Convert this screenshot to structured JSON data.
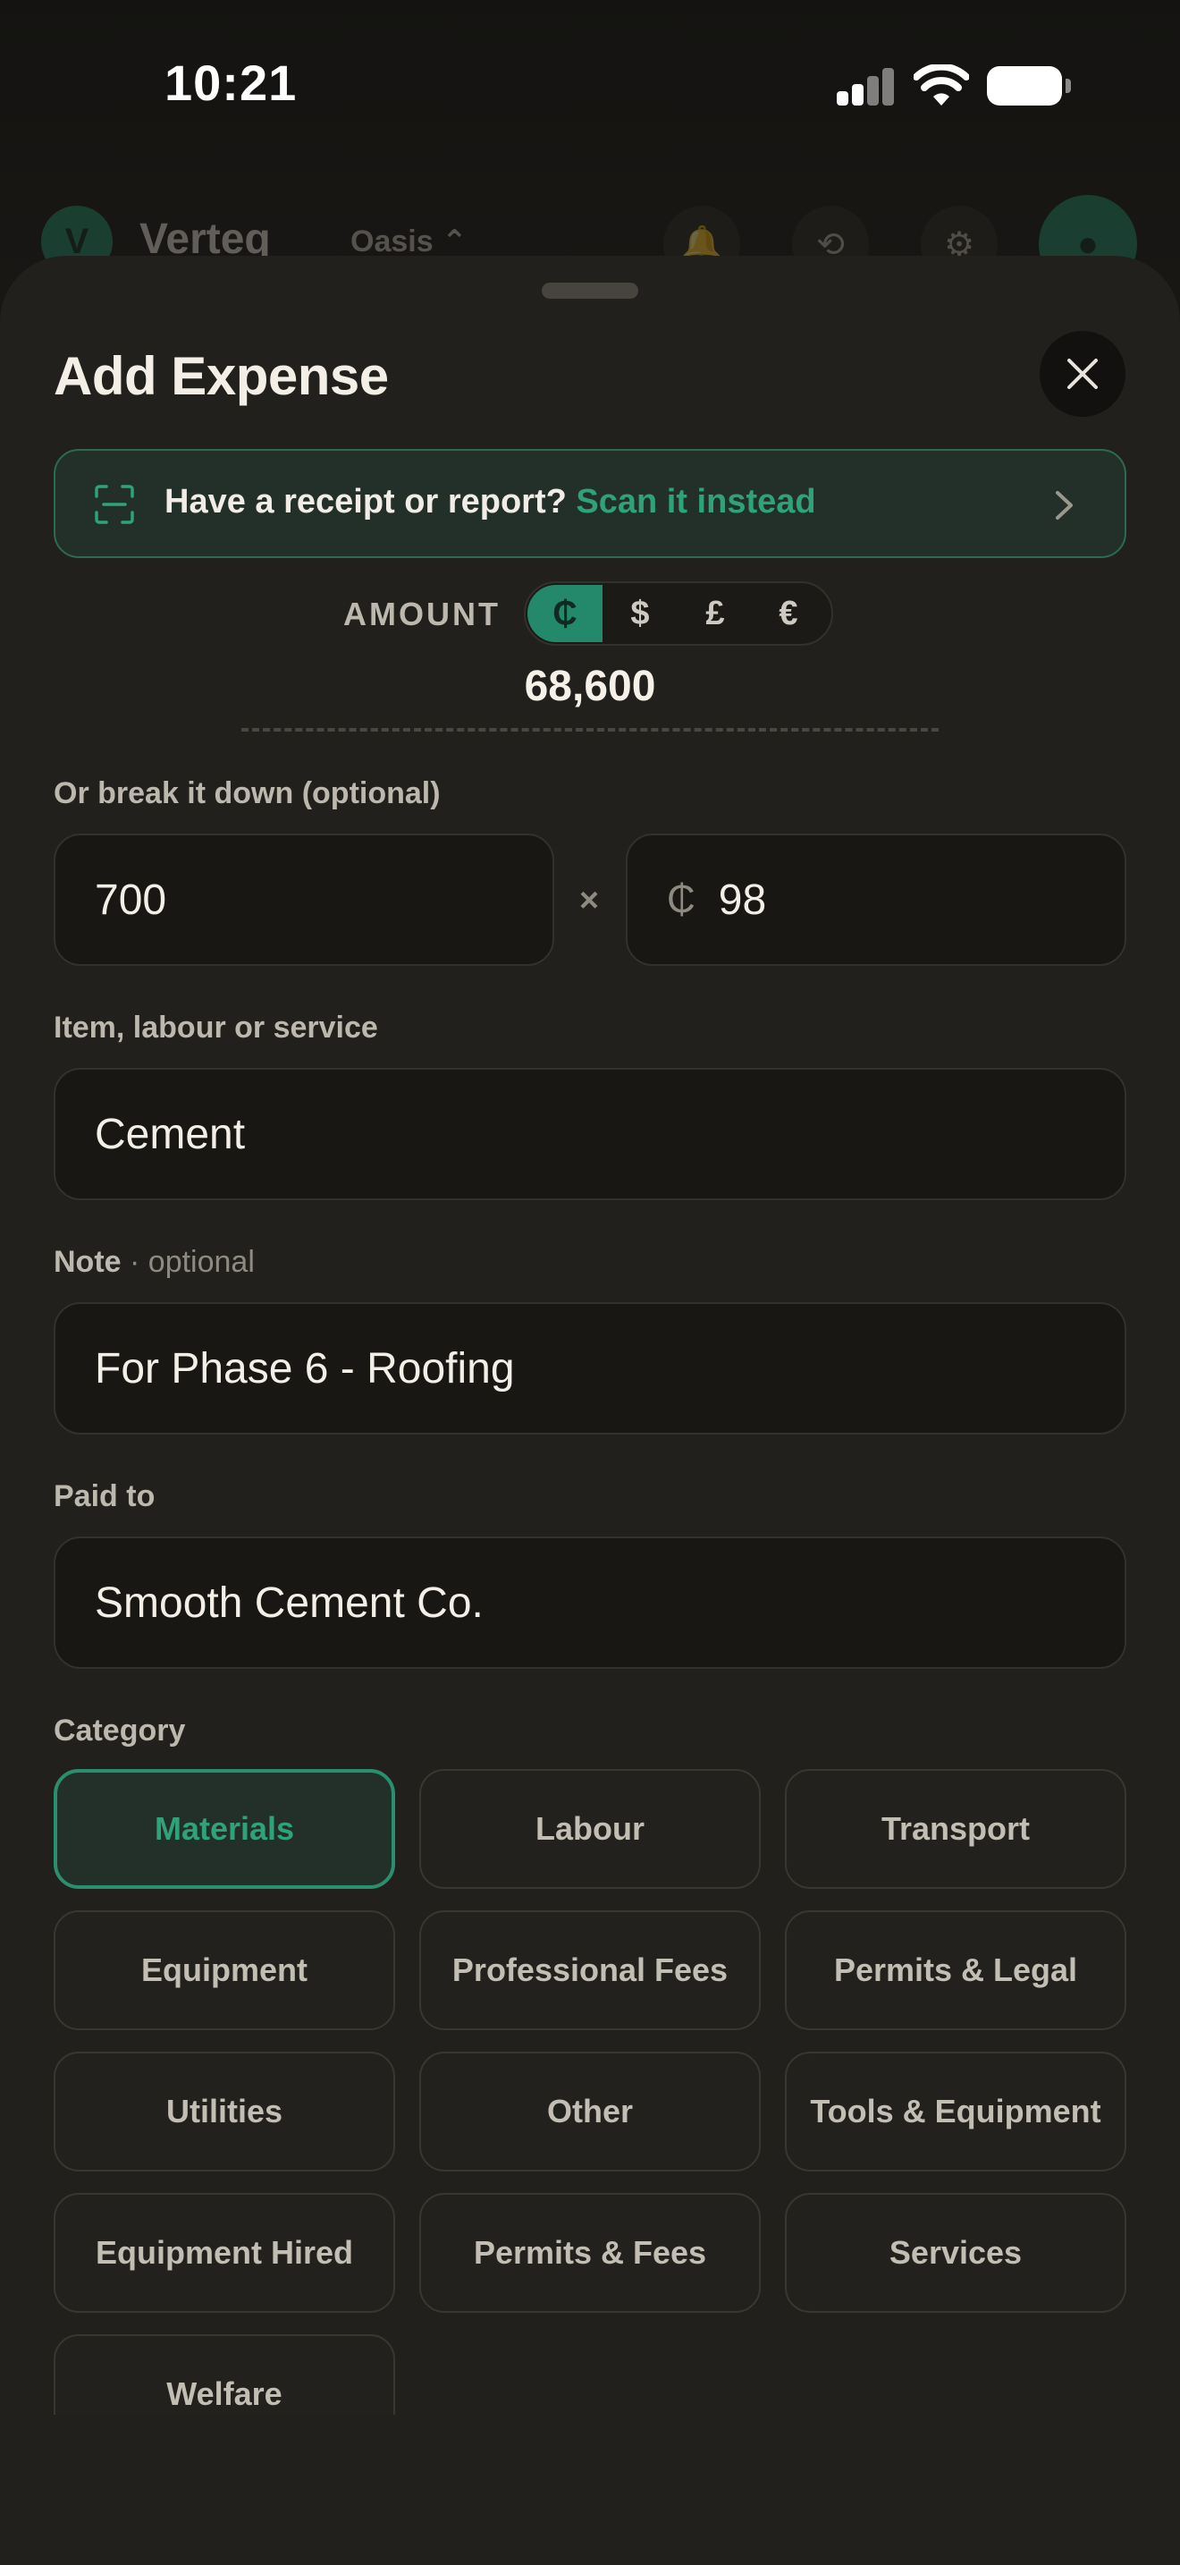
{
  "status": {
    "time": "10:21"
  },
  "app_header": {
    "app_name": "Verteq",
    "logo_letter": "V",
    "project": "Oasis ⌃"
  },
  "sheet": {
    "title": "Add Expense"
  },
  "scan": {
    "prompt": "Have a receipt or report?",
    "link": "Scan it instead"
  },
  "amount": {
    "label": "AMOUNT",
    "currencies": [
      "₵",
      "$",
      "£",
      "€"
    ],
    "selected_currency": "₵",
    "value": "68,600"
  },
  "breakdown": {
    "label": "Or break it down (optional)",
    "quantity": "700",
    "times_symbol": "×",
    "unit_currency": "₵",
    "unit_price": "98"
  },
  "item": {
    "label": "Item, labour or service",
    "value": "Cement"
  },
  "note": {
    "label": "Note",
    "optional": "· optional",
    "value": "For Phase 6 - Roofing"
  },
  "paid_to": {
    "label": "Paid to",
    "value": "Smooth Cement Co."
  },
  "category": {
    "label": "Category",
    "selected": "Materials",
    "options": [
      "Materials",
      "Labour",
      "Transport",
      "Equipment",
      "Professional Fees",
      "Permits & Legal",
      "Utilities",
      "Other",
      "Tools & Equipment",
      "Equipment Hired",
      "Permits & Fees",
      "Services",
      "Welfare"
    ]
  },
  "colors": {
    "accent": "#2fa27a",
    "sheet_bg": "#22201c",
    "input_bg": "#181714"
  }
}
